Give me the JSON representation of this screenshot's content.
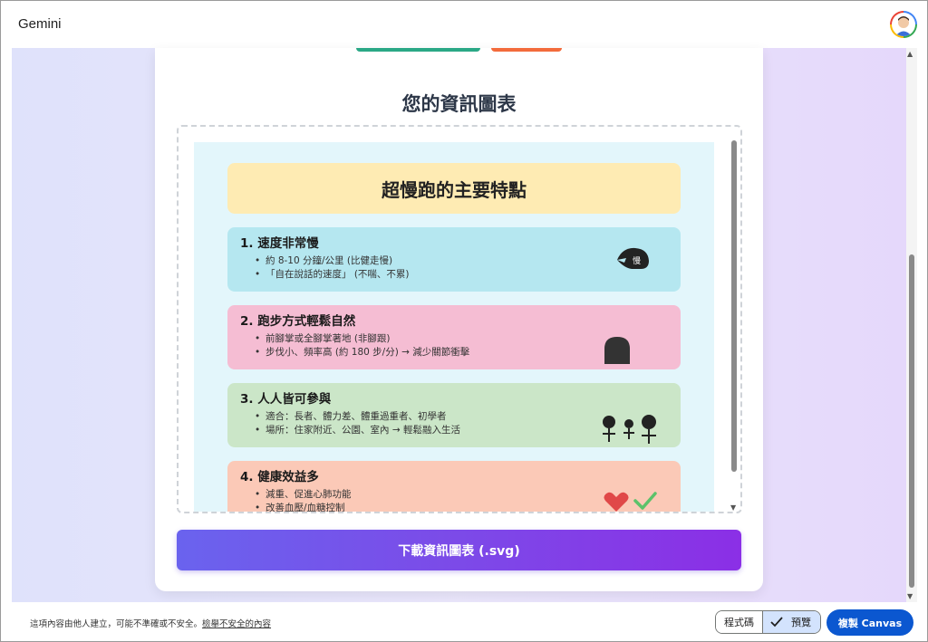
{
  "app": {
    "title": "Gemini"
  },
  "card": {
    "title": "您的資訊圖表",
    "download_label": "下載資訊圖表 (.svg)"
  },
  "infographic": {
    "title": "超慢跑的主要特點",
    "sections": [
      {
        "title": "1. 速度非常慢",
        "bullets": [
          "約 8-10 分鐘/公里 (比健走慢)",
          "「自在說話的速度」 (不喘、不累)"
        ],
        "icon": "turtle-shell-icon",
        "icon_text": "慢",
        "color": "#b5e7f0"
      },
      {
        "title": "2. 跑步方式輕鬆自然",
        "bullets": [
          "前腳掌或全腳掌著地 (非腳跟)",
          "步伐小、頻率高 (約 180 步/分) → 減少關節衝擊"
        ],
        "icon": "shoe-icon",
        "color": "#f5bdd3"
      },
      {
        "title": "3. 人人皆可參與",
        "bullets": [
          "適合：長者、體力差、體重過重者、初學者",
          "場所：住家附近、公園、室內 → 輕鬆融入生活"
        ],
        "icon": "people-icon",
        "color": "#cbe6c8"
      },
      {
        "title": "4. 健康效益多",
        "bullets": [
          "減重、促進心肺功能",
          "改善血壓/血糖控制"
        ],
        "icon": "heart-check-icon",
        "color": "#fbc9b7"
      }
    ]
  },
  "footer": {
    "disclaimer": "這項內容由他人建立，可能不準確或不安全。",
    "report_link": "檢舉不安全的內容",
    "code_label": "程式碼",
    "preview_label": "預覽",
    "copy_label": "複製 Canvas"
  }
}
